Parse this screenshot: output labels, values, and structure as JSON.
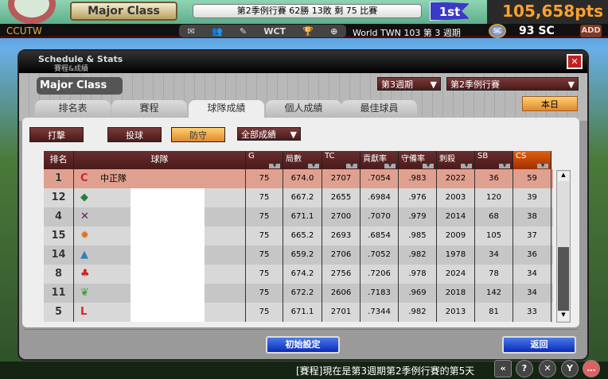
{
  "top": {
    "class": "Major Class",
    "season_record": "第2季例行賽 62勝 13敗  剩 75 比賽",
    "rank": "1st",
    "points": "105,658pts"
  },
  "bar2": {
    "user": "CCUTW",
    "icons": [
      "mail-icon",
      "friends-icon",
      "edit-icon",
      "WCT",
      "trophy-icon",
      "plus-icon"
    ],
    "wct": "WCT",
    "world": "World TWN 103 第 3 週期",
    "sc": "93 SC",
    "sc_coin": "SC",
    "add": "ADD"
  },
  "window": {
    "title": "Schedule & Stats",
    "subtitle": "賽程&成績",
    "league": "Major Class",
    "week": "第3週期",
    "season": "第2季例行賽",
    "today": "本日",
    "tabs": [
      "排名表",
      "賽程",
      "球隊成績",
      "個人成績",
      "最佳球員"
    ],
    "active_tab": 2,
    "filters": [
      "打擊",
      "投球",
      "防守"
    ],
    "active_filter": 2,
    "scope": "全部成績",
    "columns": [
      "排名",
      "球隊",
      "G",
      "局數",
      "TC",
      "貢獻率",
      "守備率",
      "刺殺",
      "SB",
      "CS"
    ],
    "rows": [
      [
        "1",
        "中正隊",
        "75",
        "674.0",
        "2707",
        ".7054",
        ".983",
        "2022",
        "36",
        "59"
      ],
      [
        "12",
        "",
        "75",
        "667.2",
        "2655",
        ".6984",
        ".976",
        "2003",
        "120",
        "39"
      ],
      [
        "4",
        "",
        "75",
        "671.1",
        "2700",
        ".7070",
        ".979",
        "2014",
        "68",
        "38"
      ],
      [
        "15",
        "",
        "75",
        "665.2",
        "2693",
        ".6854",
        ".985",
        "2009",
        "105",
        "37"
      ],
      [
        "14",
        "",
        "75",
        "659.2",
        "2706",
        ".7052",
        ".982",
        "1978",
        "34",
        "36"
      ],
      [
        "8",
        "",
        "75",
        "674.2",
        "2756",
        ".7206",
        ".978",
        "2024",
        "78",
        "34"
      ],
      [
        "11",
        "",
        "75",
        "672.2",
        "2606",
        ".7183",
        ".969",
        "2018",
        "142",
        "34"
      ],
      [
        "5",
        "",
        "75",
        "671.1",
        "2701",
        ".7344",
        ".982",
        "2013",
        "81",
        "33"
      ]
    ],
    "logos": [
      {
        "glyph": "C",
        "color": "#d02040"
      },
      {
        "glyph": "◆",
        "color": "#208040"
      },
      {
        "glyph": "✕",
        "color": "#602060"
      },
      {
        "glyph": "✹",
        "color": "#e07020"
      },
      {
        "glyph": "▲",
        "color": "#3080c0"
      },
      {
        "glyph": "♣",
        "color": "#d02020"
      },
      {
        "glyph": "❦",
        "color": "#40a040"
      },
      {
        "glyph": "L",
        "color": "#e02020"
      }
    ],
    "reset": "初始設定",
    "back": "返回"
  },
  "ticker": "[賽程]現在是第3週期第2季例行賽的第5天",
  "controls": [
    "«",
    "?",
    "✕",
    "Y",
    "…"
  ],
  "colors": {
    "header": "#4a1a1a",
    "active": "#e08830",
    "highlight": "#e0a090",
    "button": "#0a2ab8"
  }
}
